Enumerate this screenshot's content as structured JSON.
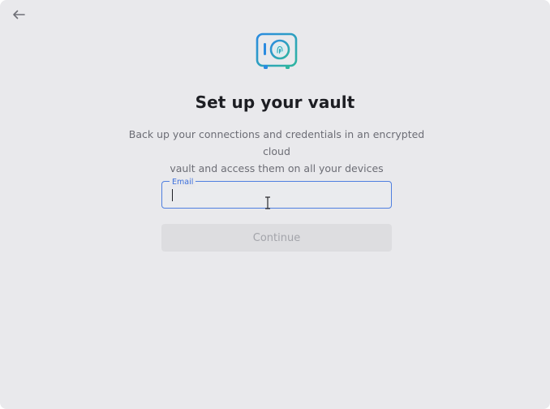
{
  "nav": {
    "back_icon": "arrow-left-icon"
  },
  "hero": {
    "logo_icon": "vault-fingerprint-icon"
  },
  "heading": {
    "title": "Set up your vault",
    "subtitle_line1": "Back up your connections and credentials in an encrypted cloud",
    "subtitle_line2": "vault and access them on all your devices"
  },
  "form": {
    "email": {
      "label": "Email",
      "value": "",
      "placeholder": ""
    },
    "continue_label": "Continue",
    "continue_enabled": false
  },
  "colors": {
    "background": "#e9e9ec",
    "focus_accent": "#3c6fdc",
    "logo_blue": "#2b8be0",
    "logo_green": "#2fb5a0",
    "title": "#1d1e23",
    "disabled_text": "#a3a4aa"
  }
}
